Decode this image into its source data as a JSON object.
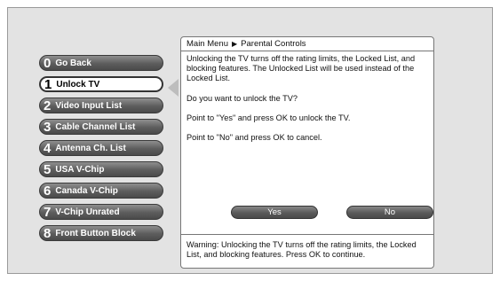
{
  "menu": {
    "items": [
      {
        "num": "0",
        "label": "Go Back"
      },
      {
        "num": "1",
        "label": "Unlock TV"
      },
      {
        "num": "2",
        "label": "Video Input List"
      },
      {
        "num": "3",
        "label": "Cable Channel List"
      },
      {
        "num": "4",
        "label": "Antenna Ch. List"
      },
      {
        "num": "5",
        "label": "USA V-Chip"
      },
      {
        "num": "6",
        "label": "Canada V-Chip"
      },
      {
        "num": "7",
        "label": "V-Chip Unrated"
      },
      {
        "num": "8",
        "label": "Front Button Block"
      }
    ],
    "selected": "1"
  },
  "breadcrumb": {
    "part1": "Main Menu",
    "separator": "▶",
    "part2": "Parental Controls"
  },
  "content": {
    "p1": "Unlocking the TV turns off the rating limits, the Locked List, and blocking features. The Unlocked List will be used instead of the Locked List.",
    "p2": "Do you want to unlock the TV?",
    "p3": "Point to \"Yes\" and press OK to unlock the TV.",
    "p4": "Point to \"No\" and press OK to cancel."
  },
  "buttons": {
    "yes": "Yes",
    "no": "No"
  },
  "warning": "Warning: Unlocking the TV turns off the rating limits, the Locked List, and blocking features. Press OK to continue."
}
